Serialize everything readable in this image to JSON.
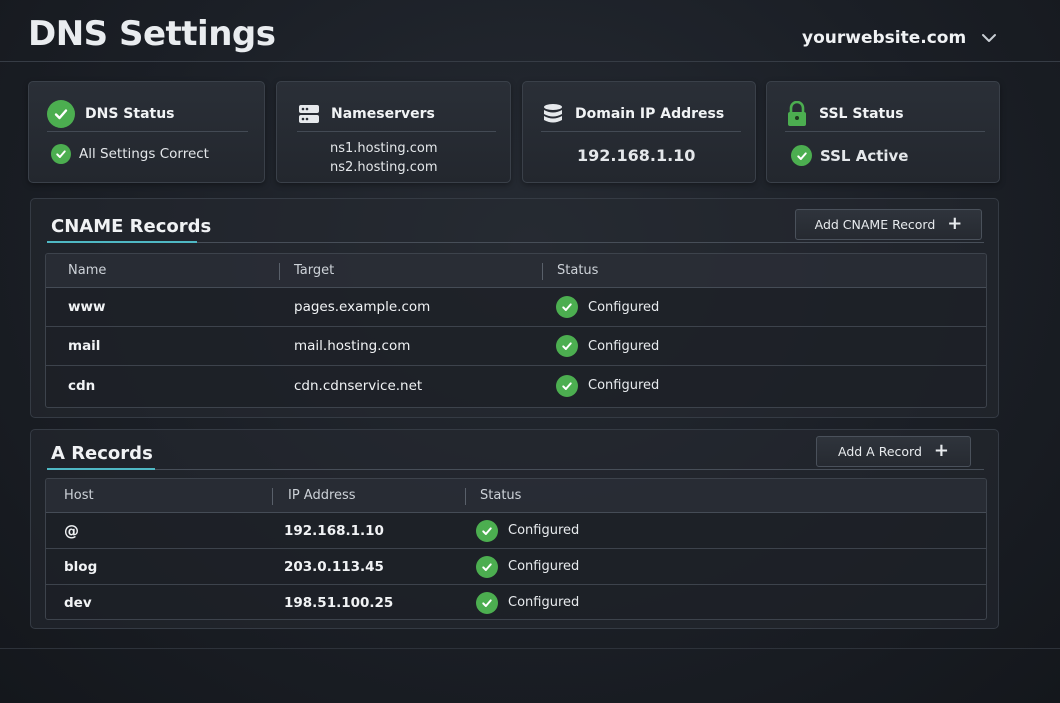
{
  "header": {
    "title": "DNS Settings",
    "domain": "yourwebsite.com"
  },
  "cards": {
    "dns": {
      "title": "DNS Status",
      "value": "All Settings Correct",
      "icon": "check-circle-icon"
    },
    "nameservers": {
      "title": "Nameservers",
      "values": [
        "ns1.hosting.com",
        "ns2.hosting.com"
      ],
      "icon": "server-icon"
    },
    "ip": {
      "title": "Domain IP Address",
      "value": "192.168.1.10",
      "icon": "database-icon"
    },
    "ssl": {
      "title": "SSL Status",
      "value": "SSL Active",
      "icon": "lock-icon"
    }
  },
  "cname": {
    "title": "CNAME Records",
    "add_label": "Add CNAME Record",
    "columns": [
      "Name",
      "Target",
      "Status"
    ],
    "rows": [
      {
        "name": "www",
        "target": "pages.example.com",
        "status": "Configured"
      },
      {
        "name": "mail",
        "target": "mail.hosting.com",
        "status": "Configured"
      },
      {
        "name": "cdn",
        "target": "cdn.cdnservice.net",
        "status": "Configured"
      }
    ]
  },
  "a_records": {
    "title": "A Records",
    "add_label": "Add A Record",
    "columns": [
      "Host",
      "IP Address",
      "Status"
    ],
    "rows": [
      {
        "host": "@",
        "ip": "192.168.1.10",
        "status": "Configured"
      },
      {
        "host": "blog",
        "ip": "203.0.113.45",
        "status": "Configured"
      },
      {
        "host": "dev",
        "ip": "198.51.100.25",
        "status": "Configured"
      }
    ]
  },
  "colors": {
    "accent": "#4fb8c4",
    "success": "#4cae50",
    "background": "#1b1f26"
  }
}
